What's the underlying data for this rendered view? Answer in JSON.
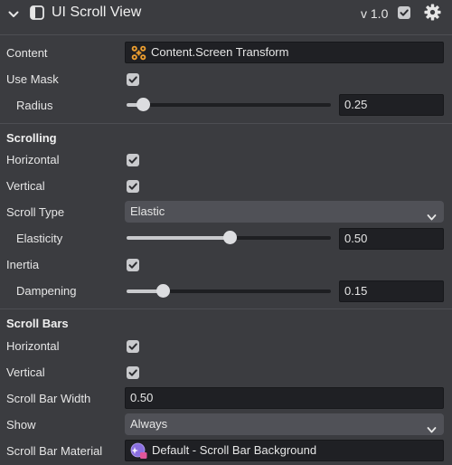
{
  "header": {
    "title": "UI Scroll View",
    "version": "v 1.0",
    "enabled": true
  },
  "content": {
    "label": "Content",
    "value": "Content.Screen Transform",
    "icon": "transform-icon"
  },
  "use_mask": {
    "label": "Use Mask",
    "checked": true
  },
  "radius": {
    "label": "Radius",
    "value": "0.25",
    "fraction": 0.08
  },
  "scrolling": {
    "section": "Scrolling",
    "horizontal": {
      "label": "Horizontal",
      "checked": true
    },
    "vertical": {
      "label": "Vertical",
      "checked": true
    },
    "scroll_type": {
      "label": "Scroll Type",
      "value": "Elastic"
    },
    "elasticity": {
      "label": "Elasticity",
      "value": "0.50",
      "fraction": 0.5
    },
    "inertia": {
      "label": "Inertia",
      "checked": true
    },
    "dampening": {
      "label": "Dampening",
      "value": "0.15",
      "fraction": 0.18
    }
  },
  "scroll_bars": {
    "section": "Scroll Bars",
    "horizontal": {
      "label": "Horizontal",
      "checked": true
    },
    "vertical": {
      "label": "Vertical",
      "checked": true
    },
    "width": {
      "label": "Scroll Bar Width",
      "value": "0.50"
    },
    "show": {
      "label": "Show",
      "value": "Always"
    },
    "material": {
      "label": "Scroll Bar Material",
      "value": "Default - Scroll Bar Background",
      "icon": "material-icon"
    }
  },
  "colors": {
    "panel_bg": "#3b3c40",
    "field_bg": "#1f2024",
    "dropdown_bg": "#505157",
    "accent_orange": "#f0a030",
    "accent_purple": "#8a6fe0"
  }
}
